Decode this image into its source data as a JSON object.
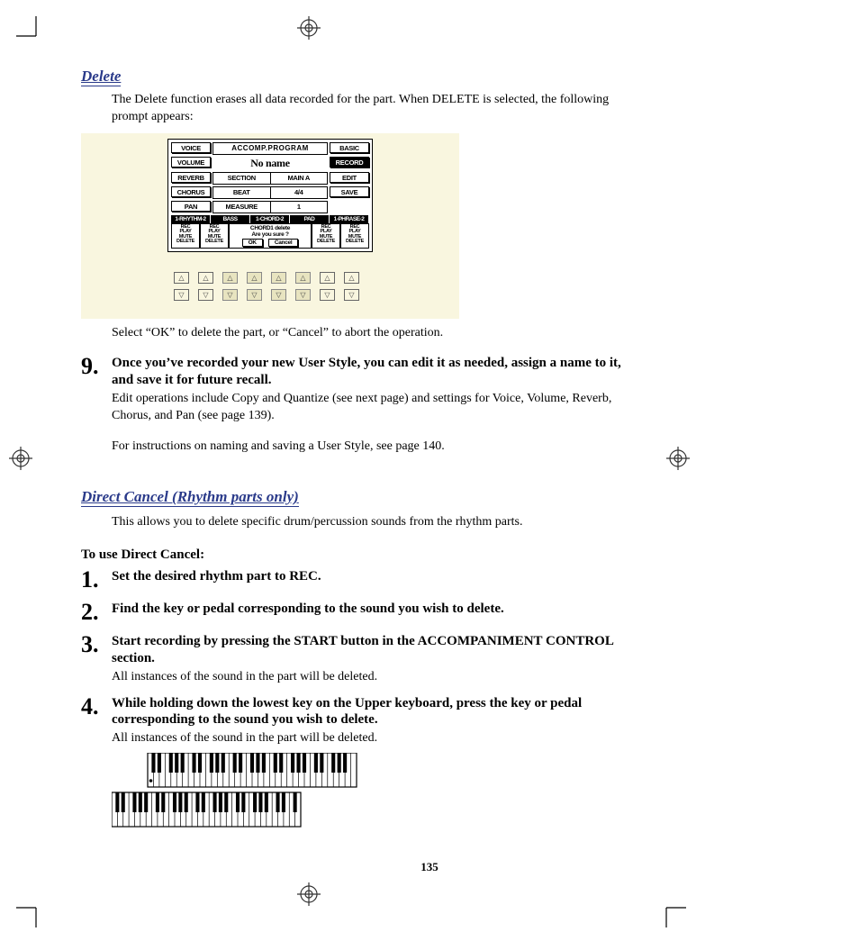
{
  "page_number": "135",
  "delete_section": {
    "title": "Delete",
    "intro": "The Delete function erases all data recorded for the part.  When DELETE is selected, the following prompt appears:",
    "caption": "Select “OK” to delete the part, or “Cancel” to abort the operation."
  },
  "lcd": {
    "title": "ACCOMP.PROGRAM",
    "name": "No name",
    "left": [
      "VOICE",
      "VOLUME",
      "REVERB",
      "CHORUS",
      "PAN"
    ],
    "right": [
      "BASIC",
      "RECORD",
      "EDIT",
      "SAVE"
    ],
    "rows": [
      {
        "label": "SECTION",
        "value": "MAIN A"
      },
      {
        "label": "BEAT",
        "value": "4/4"
      },
      {
        "label": "MEASURE",
        "value": "1"
      }
    ],
    "tabs": [
      "1-RHYTHM-2",
      "BASS",
      "1-CHORD-2",
      "PAD",
      "1-PHRASE-2"
    ],
    "bottom_labels": "REC\nPLAY\nMUTE\nDELETE",
    "prompt_line1": "CHORD1 delete",
    "prompt_line2": "Are you sure ?",
    "ok": "OK",
    "cancel": "Cancel"
  },
  "step9": {
    "num": "9.",
    "bold": "Once you’ve recorded your new User Style, you can edit it as needed, assign a name to it, and save it for future recall.",
    "para1": "Edit operations include Copy and Quantize (see next page) and settings for Voice, Volume, Reverb, Chorus, and Pan (see page 139).",
    "para2": "For instructions on naming and saving a User Style, see page 140."
  },
  "direct_cancel": {
    "title": "Direct Cancel (Rhythm parts only)",
    "intro": "This allows you to delete specific drum/percussion sounds from the rhythm parts.",
    "subhead": "To use Direct Cancel:",
    "steps": [
      {
        "num": "1.",
        "bold": "Set the desired rhythm part to REC."
      },
      {
        "num": "2.",
        "bold": "Find the key or pedal corresponding to the sound you wish to delete."
      },
      {
        "num": "3.",
        "bold": "Start recording by pressing the START button in the ACCOMPANIMENT CONTROL section.",
        "reg": "All instances of the sound in the part will be deleted."
      },
      {
        "num": "4.",
        "bold": "While holding down the lowest key on the Upper keyboard, press the key or pedal corresponding to the sound you wish to delete.",
        "reg": "All instances of the sound in the part will be deleted."
      }
    ]
  }
}
